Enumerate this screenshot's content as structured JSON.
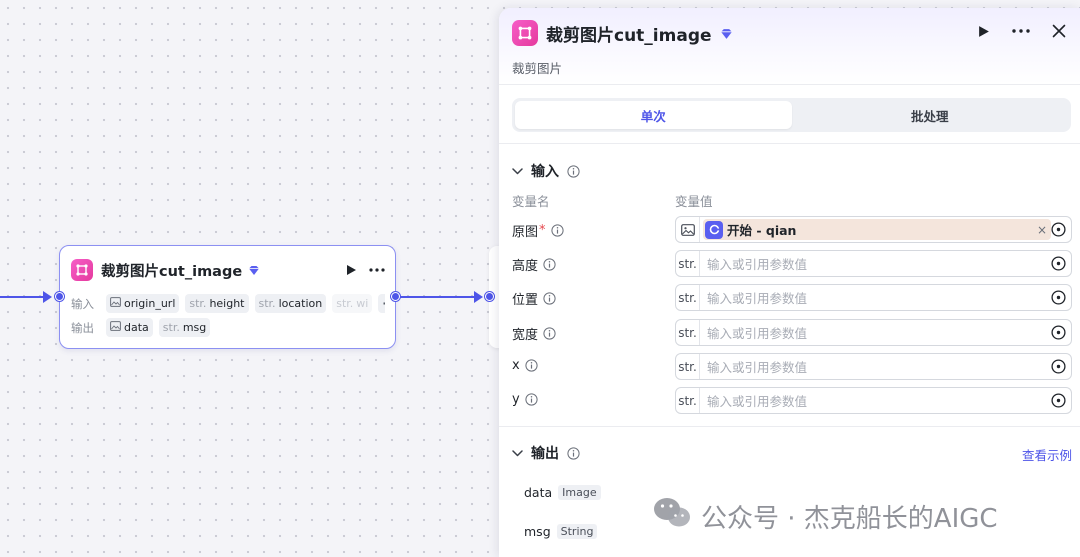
{
  "node": {
    "title": "裁剪图片cut_image",
    "inputs_label": "输入",
    "outputs_label": "输出",
    "inputs": [
      {
        "type": "",
        "name": "origin_url",
        "icon": "image-icon"
      },
      {
        "type": "str.",
        "name": "height"
      },
      {
        "type": "str.",
        "name": "location"
      },
      {
        "type": "str.",
        "name": "wi"
      }
    ],
    "more_label": "···",
    "outputs": [
      {
        "type": "",
        "name": "data",
        "icon": "image-icon"
      },
      {
        "type": "str.",
        "name": "msg"
      }
    ]
  },
  "panel": {
    "title": "裁剪图片cut_image",
    "subtitle": "裁剪图片",
    "tabs": [
      {
        "label": "单次",
        "active": true
      },
      {
        "label": "批处理",
        "active": false
      }
    ],
    "input_section": {
      "title": "输入",
      "col_name": "变量名",
      "col_value": "变量值",
      "rows": [
        {
          "label": "原图",
          "required": "*",
          "type": "image",
          "ref_text": "开始 - qian",
          "clear": "×"
        },
        {
          "label": "高度",
          "type": "str.",
          "placeholder": "输入或引用参数值"
        },
        {
          "label": "位置",
          "type": "str.",
          "placeholder": "输入或引用参数值"
        },
        {
          "label": "宽度",
          "type": "str.",
          "placeholder": "输入或引用参数值"
        },
        {
          "label": "x",
          "type": "str.",
          "placeholder": "输入或引用参数值"
        },
        {
          "label": "y",
          "type": "str.",
          "placeholder": "输入或引用参数值"
        }
      ]
    },
    "output_section": {
      "title": "输出",
      "example_link": "查看示例",
      "rows": [
        {
          "name": "data",
          "type": "Image"
        },
        {
          "name": "msg",
          "type": "String"
        }
      ]
    }
  },
  "watermark": {
    "text": "公众号 · 杰克船长的AIGC",
    "icon": "wechat-icon"
  },
  "colors": {
    "accent": "#4e55e8",
    "node_icon": "#e5399d",
    "ref_pill": "#f4e5dc"
  }
}
